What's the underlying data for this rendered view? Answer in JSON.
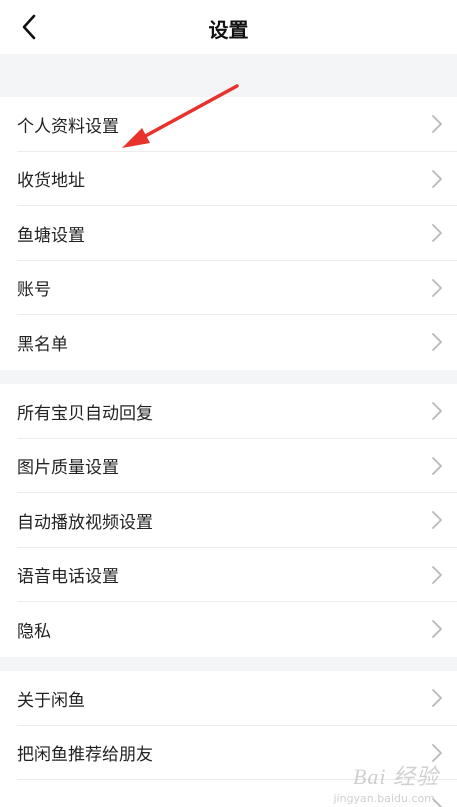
{
  "header": {
    "title": "设置",
    "back_icon": "chevron-left-icon"
  },
  "groups": [
    {
      "items": [
        {
          "label": "个人资料设置"
        },
        {
          "label": "收货地址"
        },
        {
          "label": "鱼塘设置"
        },
        {
          "label": "账号"
        },
        {
          "label": "黑名单"
        }
      ]
    },
    {
      "items": [
        {
          "label": "所有宝贝自动回复"
        },
        {
          "label": "图片质量设置"
        },
        {
          "label": "自动播放视频设置"
        },
        {
          "label": "语音电话设置"
        },
        {
          "label": "隐私"
        }
      ]
    },
    {
      "items": [
        {
          "label": "关于闲鱼"
        },
        {
          "label": "把闲鱼推荐给朋友"
        },
        {
          "label": ""
        }
      ]
    }
  ],
  "annotation": {
    "color": "#e8322b",
    "points_to": "个人资料设置"
  },
  "watermark": {
    "text": "Bai 经验",
    "sub": "jingyan.baidu.com"
  },
  "colors": {
    "background": "#f4f5f7",
    "row_background": "#ffffff",
    "text": "#222222",
    "chevron": "#b8b8b8",
    "divider": "#ececec"
  }
}
